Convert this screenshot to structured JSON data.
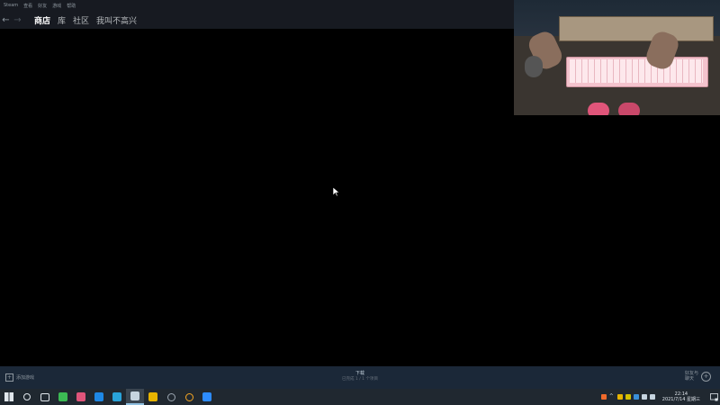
{
  "menu": [
    "Steam",
    "查看",
    "好友",
    "游戏",
    "帮助"
  ],
  "nav": {
    "back_glyph": "←",
    "forward_glyph": "→",
    "tabs": [
      "商店",
      "库",
      "社区",
      "我叫不高兴"
    ]
  },
  "bottom": {
    "add_game": "添加游戏",
    "downloads_title": "下载",
    "downloads_status": "已完成 1 / 1 个项目",
    "friends_line1": "好友与",
    "friends_line2": "聊天"
  },
  "taskbar": {
    "icons": [
      {
        "name": "windows-icon",
        "color": "#e0e6ec"
      },
      {
        "name": "search-icon",
        "color": "#e0e6ec"
      },
      {
        "name": "task-view-icon",
        "color": "#e0e6ec"
      },
      {
        "name": "app-green-icon",
        "color": "#3cba54"
      },
      {
        "name": "app-pink-icon",
        "color": "#e0557a"
      },
      {
        "name": "app-blue-icon",
        "color": "#1e88e5"
      },
      {
        "name": "app-cyan-icon",
        "color": "#29a3d9"
      },
      {
        "name": "steam-icon",
        "color": "#c6d4df"
      },
      {
        "name": "app-yellow-icon",
        "color": "#e8b400"
      },
      {
        "name": "app-gray-circle-icon",
        "color": "#9aa5b0"
      },
      {
        "name": "app-orange-icon",
        "color": "#f5a623"
      },
      {
        "name": "app-blue-square-icon",
        "color": "#2d8cff"
      }
    ],
    "active_index": 7
  },
  "tray": {
    "time": "22:14",
    "date": "2021/7/14 星期三",
    "icons": [
      {
        "name": "app-tray-icon",
        "color": "#f06a2b"
      },
      {
        "name": "chevron-up-icon",
        "color": "#c6d4df"
      },
      {
        "name": "folder-tray-icon",
        "color": "#e8b400"
      },
      {
        "name": "app-tray-yellow-icon",
        "color": "#d4c000"
      },
      {
        "name": "app-tray-blue-icon",
        "color": "#3a8fd9"
      },
      {
        "name": "network-icon",
        "color": "#c6d4df"
      },
      {
        "name": "volume-icon",
        "color": "#c6d4df"
      }
    ]
  },
  "colors": {
    "steam_dark": "#171a21",
    "steam_bottom": "#1b2838",
    "taskbar": "#202830"
  }
}
